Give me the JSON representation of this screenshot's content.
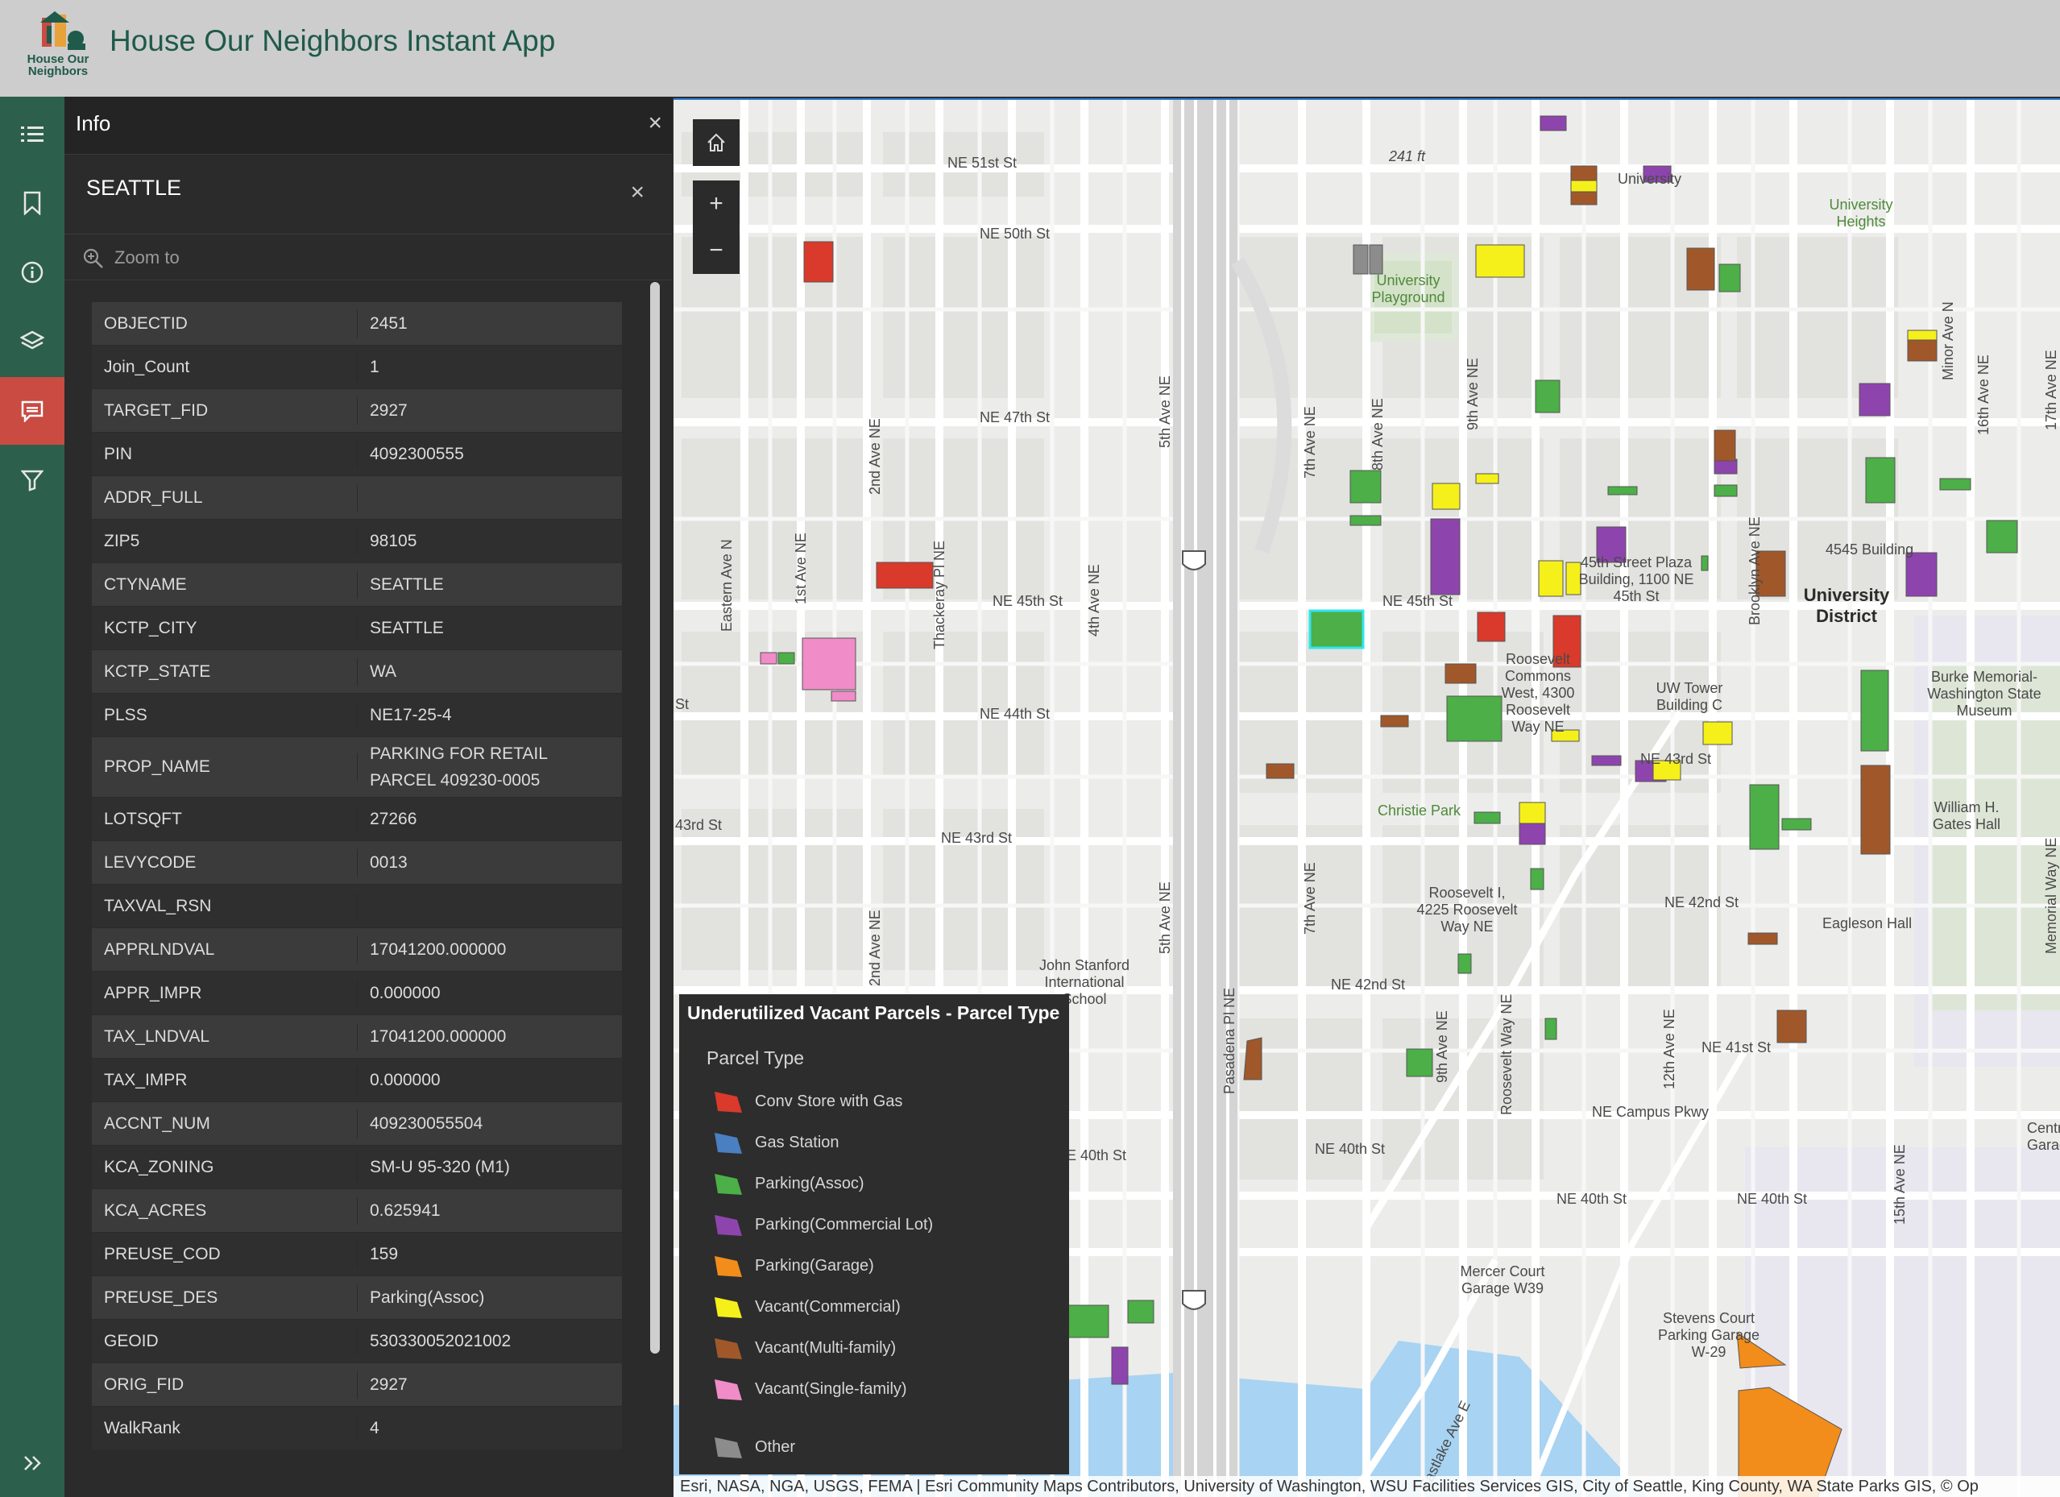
{
  "app": {
    "title": "House Our Neighbors Instant App",
    "logo_text": "House Our Neighbors"
  },
  "rail": {
    "icons": [
      "list-icon",
      "bookmark-icon",
      "info-icon",
      "layers-icon",
      "popup-icon",
      "filter-icon"
    ],
    "active": "popup-icon",
    "expand": "expand-icon"
  },
  "info_panel": {
    "title": "Info",
    "feature_title": "SEATTLE",
    "zoom_label": "Zoom to",
    "attributes": [
      {
        "key": "OBJECTID",
        "value": "2451"
      },
      {
        "key": "Join_Count",
        "value": "1"
      },
      {
        "key": "TARGET_FID",
        "value": "2927"
      },
      {
        "key": "PIN",
        "value": "4092300555"
      },
      {
        "key": "ADDR_FULL",
        "value": ""
      },
      {
        "key": "ZIP5",
        "value": "98105"
      },
      {
        "key": "CTYNAME",
        "value": "SEATTLE"
      },
      {
        "key": "KCTP_CITY",
        "value": "SEATTLE"
      },
      {
        "key": "KCTP_STATE",
        "value": "WA"
      },
      {
        "key": "PLSS",
        "value": "NE17-25-4"
      },
      {
        "key": "PROP_NAME",
        "value": "PARKING FOR RETAIL PARCEL 409230-0005"
      },
      {
        "key": "LOTSQFT",
        "value": "27266"
      },
      {
        "key": "LEVYCODE",
        "value": "0013"
      },
      {
        "key": "TAXVAL_RSN",
        "value": ""
      },
      {
        "key": "APPRLNDVAL",
        "value": "17041200.000000"
      },
      {
        "key": "APPR_IMPR",
        "value": "0.000000"
      },
      {
        "key": "TAX_LNDVAL",
        "value": "17041200.000000"
      },
      {
        "key": "TAX_IMPR",
        "value": "0.000000"
      },
      {
        "key": "ACCNT_NUM",
        "value": "409230055504"
      },
      {
        "key": "KCA_ZONING",
        "value": "SM-U 95-320 (M1)"
      },
      {
        "key": "KCA_ACRES",
        "value": "0.625941"
      },
      {
        "key": "PREUSE_COD",
        "value": "159"
      },
      {
        "key": "PREUSE_DES",
        "value": "Parking(Assoc)"
      },
      {
        "key": "GEOID",
        "value": "530330052021002"
      },
      {
        "key": "ORIG_FID",
        "value": "2927"
      },
      {
        "key": "WalkRank",
        "value": "4"
      }
    ]
  },
  "map": {
    "controls": {
      "home": "home-icon",
      "zoom_in": "+",
      "zoom_out": "−"
    },
    "labels": [
      "NE 51st St",
      "NE 50th St",
      "NE 47th St",
      "NE 45th St",
      "NE 44th St",
      "NE 43rd St",
      "NE 42nd St",
      "NE 41st St",
      "NE 40th St",
      "NE Campus Pkwy",
      "University",
      "University Heights",
      "University Playground",
      "University District",
      "4545 Building",
      "Christie Park",
      "John Stanford International School",
      "Mercer Court Garage W39",
      "Stevens Court Parking Garage W-29",
      "William H. Gates Hall",
      "Eagleson Hall",
      "UW Tower Building C",
      "241 ft",
      "Eastern Ave N",
      "1st Ave NE",
      "2nd Ave NE",
      "Thackeray Pl NE",
      "4th Ave NE",
      "5th Ave NE",
      "7th Ave NE",
      "8th Ave NE",
      "9th Ave NE",
      "Roosevelt Way NE",
      "Brooklyn Ave NE",
      "12th Ave NE",
      "15th Ave NE",
      "16th Ave NE",
      "Pasadena Pl NE",
      "Eastlake Ave E",
      "Burke Memorial-Washington State Museum",
      "Roosevelt Commons West, 4300 Roosevelt Way NE",
      "Roosevelt I, 4225 Roosevelt Way NE",
      "45th Street Plaza Building, 1100 NE 45th St",
      "Minor Ave N",
      "Memorial Way NE",
      "17th Ave NE",
      "NE 43rd St",
      "Central Garage",
      "St",
      "43rd St",
      "E 40th St"
    ],
    "attribution": "Esri, NASA, NGA, USGS, FEMA | Esri Community Maps Contributors, University of Washington, WSU Facilities Services GIS, City of Seattle, King County, WA State Parks GIS, © Op"
  },
  "legend": {
    "title": "Underutilized Vacant Parcels - Parcel Type",
    "subtitle": "Parcel Type",
    "items": [
      {
        "label": "Conv Store with Gas",
        "color": "#d93a2b"
      },
      {
        "label": "Gas Station",
        "color": "#4a7fc1"
      },
      {
        "label": "Parking(Assoc)",
        "color": "#4caf47"
      },
      {
        "label": "Parking(Commercial Lot)",
        "color": "#8e44ad"
      },
      {
        "label": "Parking(Garage)",
        "color": "#f28c1a"
      },
      {
        "label": "Vacant(Commercial)",
        "color": "#f5f01a"
      },
      {
        "label": "Vacant(Multi-family)",
        "color": "#a0582a"
      },
      {
        "label": "Vacant(Single-family)",
        "color": "#f08cc8"
      },
      {
        "label": "Other",
        "color": "#8c8c8c"
      }
    ]
  }
}
